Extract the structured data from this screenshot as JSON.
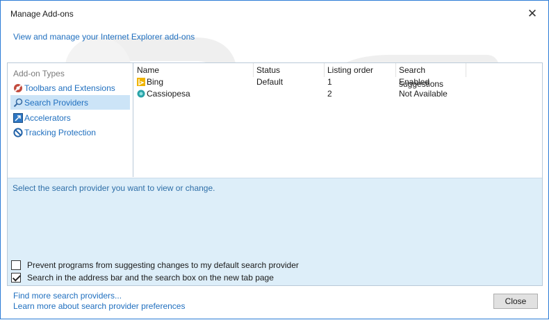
{
  "window": {
    "title": "Manage Add-ons",
    "close_glyph": "✕"
  },
  "header": {
    "link_text": "View and manage your Internet Explorer add-ons"
  },
  "sidebar": {
    "heading": "Add-on Types",
    "items": [
      {
        "label": "Toolbars and Extensions",
        "icon": "toolbars-extensions-icon",
        "selected": false
      },
      {
        "label": "Search Providers",
        "icon": "search-icon",
        "selected": true
      },
      {
        "label": "Accelerators",
        "icon": "accelerators-icon",
        "selected": false
      },
      {
        "label": "Tracking Protection",
        "icon": "tracking-protection-icon",
        "selected": false
      }
    ]
  },
  "table": {
    "columns": [
      "Name",
      "Status",
      "Listing order",
      "Search suggestions"
    ],
    "rows": [
      {
        "name": "Bing",
        "icon": "bing-icon",
        "status": "Default",
        "order": "1",
        "suggestions": "Enabled"
      },
      {
        "name": "Cassiopesa",
        "icon": "cassiopesa-icon",
        "status": "",
        "order": "2",
        "suggestions": "Not Available"
      }
    ]
  },
  "details": {
    "hint": "Select the search provider you want to view or change.",
    "options": [
      {
        "label": "Prevent programs from suggesting changes to my default search provider",
        "checked": false
      },
      {
        "label": "Search in the address bar and the search box on the new tab page",
        "checked": true
      }
    ]
  },
  "footer": {
    "links": [
      "Find more search providers...",
      "Learn more about search provider preferences"
    ],
    "close_label": "Close"
  },
  "watermark": {
    "lines": [
      "PC",
      "risk.com"
    ]
  },
  "colors": {
    "accent": "#1f6fbf",
    "selection": "#cce4f7",
    "details_bg": "#ddeef9",
    "border": "#2b7bd6"
  }
}
